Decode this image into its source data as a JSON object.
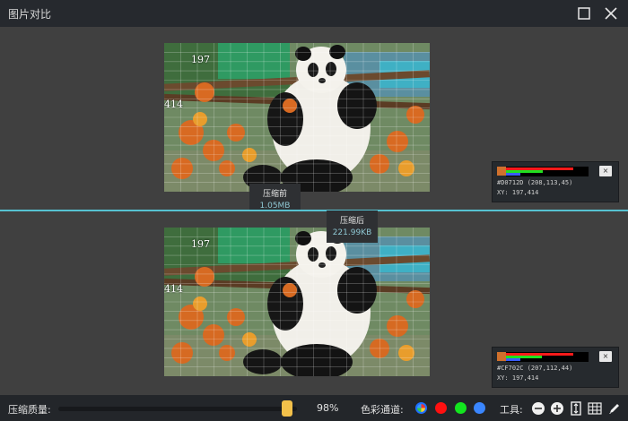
{
  "window": {
    "title": "图片对比"
  },
  "top_panel": {
    "coord_x": "197",
    "coord_y": "414",
    "size_label": "压缩前",
    "size_value": "1.05MB",
    "color_info": {
      "swatch_color": "#D0712D",
      "hex_text": "#D0712D (208,113,45)",
      "xy_text": "XY: 197,414",
      "r": 208,
      "g": 113,
      "b": 45,
      "close_label": "×"
    }
  },
  "bottom_panel": {
    "coord_x": "197",
    "coord_y": "414",
    "size_label": "压缩后",
    "size_value": "221.99KB",
    "color_info": {
      "swatch_color": "#CF702C",
      "hex_text": "#CF702C (207,112,44)",
      "xy_text": "XY: 197,414",
      "r": 207,
      "g": 112,
      "b": 44,
      "close_label": "×"
    }
  },
  "toolbar": {
    "quality_label": "压缩质量:",
    "quality_value": 0.98,
    "quality_text": "98%",
    "channel_label": "色彩通道:",
    "channels": [
      "all-channels",
      "red",
      "green",
      "blue"
    ],
    "tools_label": "工具:",
    "tools": [
      "zoom-out-icon",
      "zoom-in-icon",
      "fit-icon",
      "grid-icon",
      "pen-icon"
    ]
  },
  "colors": {
    "accent_divider": "#56C2D1",
    "slider_handle": "#F2C04A"
  }
}
